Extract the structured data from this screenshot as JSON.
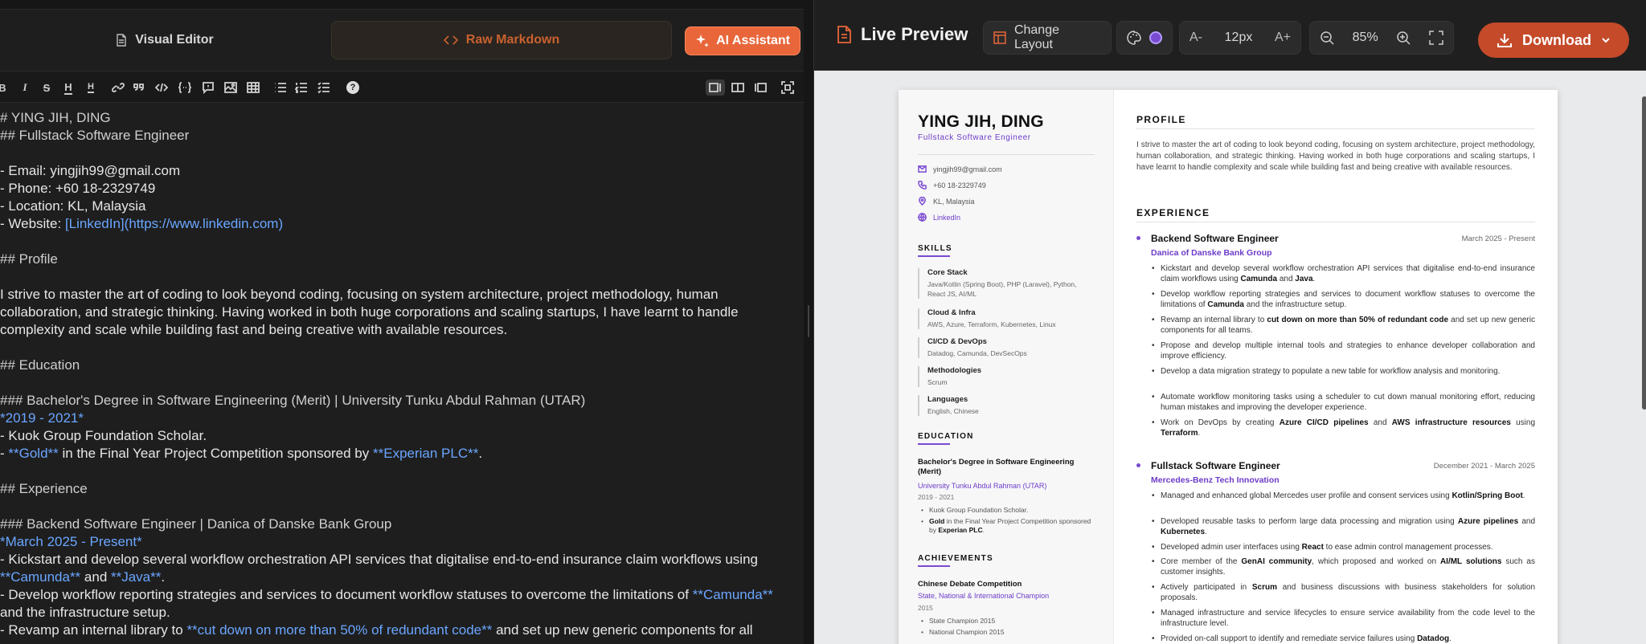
{
  "editor_tabs": {
    "visual": "Visual Editor",
    "raw": "Raw Markdown",
    "ai": "AI Assistant"
  },
  "toolbar": {
    "bold": "B",
    "italic": "I",
    "strike": "S",
    "h": "H",
    "hh": "H",
    "help": "?"
  },
  "markdown": {
    "l1": "# YING JIH, DING",
    "l2": "## Fullstack Software Engineer",
    "l3": "- Email: yingjih99@gmail.com",
    "l4": "- Phone: +60 18-2329749",
    "l5": "- Location: KL, Malaysia",
    "l6a": "- Website: ",
    "l6b": "[LinkedIn](https://www.linkedin.com)",
    "l7": "## Profile",
    "l8": "I strive to master the art of coding to look beyond coding, focusing on system architecture, project methodology, human",
    "l9": "collaboration, and strategic thinking. Having worked in both huge corporations and scaling startups, I have learnt to handle",
    "l10": "complexity and scale while building fast and being creative with available resources.",
    "l11": "## Education",
    "l12": "### Bachelor's Degree in Software Engineering (Merit) | University Tunku Abdul Rahman (UTAR)",
    "l13": "*2019 - 2021*",
    "l14": "- Kuok Group Foundation Scholar.",
    "l15a": "- ",
    "l15b": "**Gold**",
    "l15c": " in the Final Year Project Competition sponsored by ",
    "l15d": "**Experian PLC**",
    "l15e": ".",
    "l16": "## Experience",
    "l17": "### Backend Software Engineer | Danica of Danske Bank Group",
    "l18": "*March 2025 - Present*",
    "l19": "- Kickstart and develop several workflow orchestration API services that digitalise end-to-end insurance claim workflows using",
    "l20a": "**Camunda**",
    "l20b": " and ",
    "l20c": "**Java**",
    "l20d": ".",
    "l21a": "- Develop workflow reporting strategies and services to document workflow statuses to overcome the limitations of ",
    "l21b": "**Camunda**",
    "l22": "and the infrastructure setup.",
    "l23a": "- Revamp an internal library to ",
    "l23b": "**cut down on more than 50% of redundant code**",
    "l23c": " and set up new generic components for all"
  },
  "preview_bar": {
    "title": "Live Preview",
    "change_layout": "Change Layout",
    "font_down": "A-",
    "font_size": "12px",
    "font_up": "A+",
    "zoom": "85%",
    "download": "Download",
    "accent_color": "#7a4ad1"
  },
  "resume": {
    "name": "YING JIH, DING",
    "title": "Fullstack Software Engineer",
    "email": "yingjih99@gmail.com",
    "phone": "+60 18-2329749",
    "location": "KL, Malaysia",
    "website": "LinkedIn",
    "skills_h": "SKILLS",
    "skills": [
      {
        "k": "Core Stack",
        "v": "Java/Kotlin (Spring Boot), PHP (Laravel), Python, React JS, AI/ML"
      },
      {
        "k": "Cloud & Infra",
        "v": "AWS, Azure, Terraform, Kubernetes, Linux"
      },
      {
        "k": "CI/CD & DevOps",
        "v": "Datadog, Camunda, DevSecOps"
      },
      {
        "k": "Methodologies",
        "v": "Scrum"
      },
      {
        "k": "Languages",
        "v": "English, Chinese"
      }
    ],
    "education_h": "EDUCATION",
    "edu_title": "Bachelor's Degree in Software Engineering (Merit)",
    "edu_school": "University Tunku Abdul Rahman (UTAR)",
    "edu_dates": "2019 - 2021",
    "edu_b1": "Kuok Group Foundation Scholar.",
    "edu_b2a": "Gold",
    "edu_b2b": " in the Final Year Project Competition sponsored by ",
    "edu_b2c": "Experian PLC",
    "edu_b2d": ".",
    "ach_h": "ACHIEVEMENTS",
    "ach_title": "Chinese Debate Competition",
    "ach_sub": "State, National & International Champion",
    "ach_year": "2015",
    "ach_b1": "State Champion 2015",
    "ach_b2": "National Champion 2015",
    "profile_h": "PROFILE",
    "profile": "I strive to master the art of coding to look beyond coding, focusing on system architecture, project methodology, human collaboration, and strategic thinking. Having worked in both huge corporations and scaling startups, I have learnt to handle complexity and scale while building fast and being creative with available resources.",
    "exp_h": "EXPERIENCE",
    "job1": {
      "title": "Backend Software Engineer",
      "dates": "March 2025 - Present",
      "company": "Danica of Danske Bank Group"
    },
    "job2": {
      "title": "Fullstack Software Engineer",
      "dates": "December 2021 - March 2025",
      "company": "Mercedes-Benz Tech Innovation"
    },
    "j1b1a": "Kickstart and develop several workflow orchestration API services that digitalise end-to-end insurance claim workflows using ",
    "j1b1b": "Camunda",
    "j1b1c": " and ",
    "j1b1d": "Java",
    "j1b1e": ".",
    "j1b2a": "Develop workflow reporting strategies and services to document workflow statuses to overcome the limitations of ",
    "j1b2b": "Camunda",
    "j1b2c": " and the infrastructure setup.",
    "j1b3a": "Revamp an internal library to ",
    "j1b3b": "cut down on more than 50% of redundant code",
    "j1b3c": " and set up new generic components for all teams.",
    "j1b4": "Propose and develop multiple internal tools and strategies to enhance developer collaboration and improve efficiency.",
    "j1b5": "Develop a data migration strategy to populate a new table for workflow analysis and monitoring.",
    "j1b6": "Automate workflow monitoring tasks using a scheduler to cut down manual monitoring effort, reducing human mistakes and improving the developer experience.",
    "j1b7a": "Work on DevOps by creating ",
    "j1b7b": "Azure CI/CD pipelines",
    "j1b7c": " and ",
    "j1b7d": "AWS infrastructure resources",
    "j1b7e": " using ",
    "j1b7f": "Terraform",
    "j1b7g": ".",
    "j2b1a": "Managed and enhanced global Mercedes user profile and consent services using ",
    "j2b1b": "Kotlin/Spring Boot",
    "j2b1c": ".",
    "j2b2a": "Developed reusable tasks to perform large data processing and migration using ",
    "j2b2b": "Azure pipelines",
    "j2b2c": " and ",
    "j2b2d": "Kubernetes",
    "j2b2e": ".",
    "j2b3a": "Developed admin user interfaces using ",
    "j2b3b": "React",
    "j2b3c": " to ease admin control management processes.",
    "j2b4a": "Core member of the ",
    "j2b4b": "GenAI community",
    "j2b4c": ", which proposed and worked on ",
    "j2b4d": "AI/ML solutions",
    "j2b4e": " such as customer insights.",
    "j2b5a": "Actively participated in ",
    "j2b5b": "Scrum",
    "j2b5c": " and business discussions with business stakeholders for solution proposals.",
    "j2b6": "Managed infrastructure and service lifecycles to ensure service availability from the code level to the infrastructure level.",
    "j2b7a": "Provided on-call support to identify and remediate service failures using ",
    "j2b7b": "Datadog",
    "j2b7c": "."
  }
}
